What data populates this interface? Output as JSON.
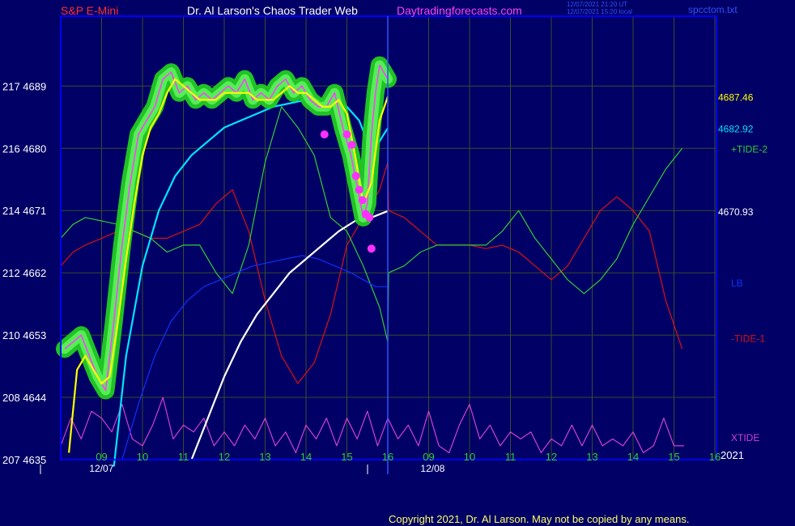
{
  "header": {
    "symbol": "S&P E-Mini",
    "site_title": "Dr. Al Larson's Chaos Trader Web",
    "site_url": "Daytradingforecasts.com",
    "time_utc": "12/07/2021 21:20 UT",
    "time_local": "12/07/2021 15:20 local",
    "file": "spcctom.txt"
  },
  "footer": {
    "copyright": "Copyright 2021, Dr. Al Larson. May not be copied by any means."
  },
  "colors": {
    "background": "#000066",
    "frame": "#0000ff",
    "grid": "#3a4d2a",
    "price_halo": "#22cc22",
    "price_line": "#ff40ff",
    "yellow_ma": "#ffff00",
    "cyan_ma": "#00e5ff",
    "white_ma": "#ffffff",
    "lb": "#1030ff",
    "tide2": "#33cc33",
    "tide1": "#dd1111",
    "xtide": "#d040d0",
    "dots": "#ff30ff"
  },
  "chart_data": {
    "type": "line",
    "title": "S&P E-Mini",
    "y_axis": {
      "ticks": [
        {
          "price": 4635,
          "label": "207  4635"
        },
        {
          "price": 4644,
          "label": "208  4644"
        },
        {
          "price": 4653,
          "label": "210  4653"
        },
        {
          "price": 4662,
          "label": "212  4662"
        },
        {
          "price": 4671,
          "label": "214  4671"
        },
        {
          "price": 4680,
          "label": "216  4680"
        },
        {
          "price": 4689,
          "label": "217  4689"
        }
      ],
      "range": [
        4635,
        4692
      ]
    },
    "x_axis": {
      "range": [
        8,
        23.25
      ],
      "hour_ticks": [
        {
          "h": 9,
          "label": "09"
        },
        {
          "h": 10,
          "label": "10"
        },
        {
          "h": 11,
          "label": "11"
        },
        {
          "h": 12,
          "label": "12"
        },
        {
          "h": 13,
          "label": "13"
        },
        {
          "h": 14,
          "label": "14"
        },
        {
          "h": 15,
          "label": "15"
        },
        {
          "h": 16,
          "label": "16"
        },
        {
          "h": 17,
          "label": "09"
        },
        {
          "h": 18,
          "label": "10"
        },
        {
          "h": 19,
          "label": "11"
        },
        {
          "h": 20,
          "label": "12"
        },
        {
          "h": 21,
          "label": "13"
        },
        {
          "h": 22,
          "label": "14"
        },
        {
          "h": 23,
          "label": "15"
        },
        {
          "h": 24,
          "label": "16"
        }
      ],
      "date_labels": [
        {
          "h": 8.7,
          "label": "12/07"
        },
        {
          "h": 16.8,
          "label": "12/08"
        }
      ],
      "year_label": "2021",
      "now_line_h": 16
    },
    "right_labels": [
      {
        "text": "4687.46",
        "price": 4687.46,
        "color": "#ffff00"
      },
      {
        "text": "4682.92",
        "price": 4682.92,
        "color": "#00e5ff"
      },
      {
        "text": "+TIDE-2",
        "price": 4680,
        "color": "#33cc33"
      },
      {
        "text": "4670.93",
        "price": 4670.93,
        "color": "#ffffff"
      },
      {
        "text": "LB",
        "price": 4660.6,
        "color": "#1030ff"
      },
      {
        "text": "-TIDE-1",
        "price": 4652.6,
        "color": "#dd1111"
      },
      {
        "text": "XTIDE",
        "price": 4638.3,
        "color": "#d040d0"
      }
    ],
    "series": [
      {
        "key": "price",
        "color": "#ff40ff",
        "halo": "#22cc22",
        "x": [
          8.1,
          8.3,
          8.5,
          8.7,
          8.9,
          9.1,
          9.3,
          9.5,
          9.7,
          9.9,
          10.1,
          10.3,
          10.5,
          10.7,
          10.9,
          11.1,
          11.3,
          11.5,
          11.7,
          11.9,
          12.1,
          12.3,
          12.5,
          12.7,
          12.9,
          13.1,
          13.3,
          13.5,
          13.7,
          13.9,
          14.1,
          14.3,
          14.5,
          14.7,
          14.9,
          15.1,
          15.2,
          15.3,
          15.4,
          15.5,
          15.6,
          15.7,
          15.8,
          15.9,
          16.0
        ],
        "y": [
          4651,
          4652,
          4653,
          4650,
          4647,
          4645,
          4655,
          4666,
          4675,
          4682,
          4684,
          4686,
          4690,
          4691,
          4688,
          4689,
          4687,
          4688,
          4687,
          4688,
          4689,
          4688,
          4690,
          4687,
          4688,
          4687,
          4689,
          4690,
          4688,
          4689,
          4687,
          4686,
          4686,
          4688,
          4683,
          4679,
          4676,
          4673,
          4670,
          4672,
          4682,
          4688,
          4692,
          4691,
          4690
        ]
      },
      {
        "key": "yellow",
        "color": "#ffff00",
        "x": [
          8.2,
          8.4,
          8.6,
          8.8,
          9.0,
          9.2,
          9.4,
          9.6,
          9.8,
          10.0,
          10.2,
          10.4,
          10.6,
          10.8,
          11.0,
          11.2,
          11.4,
          11.6,
          11.8,
          12.0,
          12.2,
          12.4,
          12.6,
          12.8,
          13.0,
          13.2,
          13.4,
          13.6,
          13.8,
          14.0,
          14.2,
          14.4,
          14.6,
          14.8,
          15.0,
          15.2,
          15.4,
          15.6,
          15.8,
          16.0
        ],
        "y": [
          4636,
          4648,
          4650,
          4648,
          4646,
          4647,
          4655,
          4664,
          4672,
          4679,
          4683,
          4685,
          4688,
          4690,
          4689,
          4688,
          4687,
          4687,
          4687,
          4688,
          4688,
          4688,
          4688,
          4687,
          4687,
          4687,
          4688,
          4689,
          4688,
          4688,
          4687,
          4686,
          4686,
          4687,
          4685,
          4679,
          4672,
          4675,
          4684,
          4687.46
        ]
      },
      {
        "key": "cyan",
        "color": "#00e5ff",
        "x": [
          9.3,
          9.6,
          10.0,
          10.4,
          10.8,
          11.2,
          11.6,
          12.0,
          12.4,
          12.8,
          13.2,
          13.6,
          14.0,
          14.4,
          14.8,
          15.0,
          15.3,
          15.5,
          15.7,
          15.9,
          16.0
        ],
        "y": [
          4634,
          4650,
          4663,
          4671,
          4676,
          4679,
          4681,
          4683,
          4684,
          4685,
          4686,
          4686.5,
          4687,
          4687,
          4686.5,
          4686,
          4684,
          4681,
          4680,
          4682,
          4682.92
        ]
      },
      {
        "key": "white",
        "color": "#ffffff",
        "x": [
          11.2,
          11.6,
          12.0,
          12.4,
          12.8,
          13.2,
          13.6,
          14.0,
          14.4,
          14.8,
          15.2,
          15.6,
          16.0
        ],
        "y": [
          4635,
          4641,
          4647,
          4652,
          4656,
          4659,
          4662,
          4664,
          4666,
          4668,
          4669.5,
          4670,
          4670.93
        ]
      },
      {
        "key": "lb",
        "color": "#1030ff",
        "x": [
          9.5,
          9.9,
          10.3,
          10.7,
          11.1,
          11.5,
          11.9,
          12.3,
          12.7,
          13.1,
          13.5,
          13.9,
          14.3,
          14.7,
          15.1,
          15.4,
          15.7,
          16.0
        ],
        "y": [
          4635,
          4643,
          4650,
          4655,
          4658,
          4660,
          4661,
          4662,
          4663,
          4663.5,
          4664,
          4664.5,
          4664,
          4663,
          4662,
          4661,
          4660,
          4660
        ]
      },
      {
        "key": "tide2",
        "color": "#33cc33",
        "x": [
          8.0,
          8.3,
          8.6,
          9.0,
          9.4,
          9.8,
          10.2,
          10.6,
          11.0,
          11.4,
          11.8,
          12.2,
          12.6,
          13.0,
          13.4,
          13.8,
          14.2,
          14.6,
          15.0,
          15.4,
          15.8,
          16.0,
          16.02,
          16.4,
          16.8,
          17.2,
          17.6,
          18.0,
          18.4,
          18.8,
          19.2,
          19.6,
          20.0,
          20.4,
          20.8,
          21.2,
          21.6,
          22.0,
          22.4,
          22.8,
          23.2
        ],
        "y": [
          4667,
          4669,
          4670,
          4669.5,
          4669,
          4668,
          4667,
          4665,
          4666,
          4666,
          4662,
          4659,
          4666,
          4678,
          4686,
          4683,
          4679,
          4670,
          4668,
          4663,
          4657,
          4652,
          4662,
          4663,
          4665,
          4666,
          4666,
          4666,
          4666,
          4668,
          4671,
          4667,
          4664,
          4661,
          4659,
          4661,
          4664,
          4669,
          4673,
          4677,
          4680
        ]
      },
      {
        "key": "tide1",
        "color": "#dd1111",
        "x": [
          8.0,
          8.3,
          8.6,
          9.0,
          9.4,
          9.8,
          10.2,
          10.6,
          11.0,
          11.4,
          11.8,
          12.2,
          12.6,
          13.0,
          13.4,
          13.8,
          14.2,
          14.6,
          15.0,
          15.4,
          15.8,
          16.0,
          16.02,
          16.4,
          16.8,
          17.2,
          17.6,
          18.0,
          18.4,
          18.8,
          19.2,
          19.6,
          20.0,
          20.4,
          20.8,
          21.2,
          21.6,
          22.0,
          22.4,
          22.8,
          23.2
        ],
        "y": [
          4663,
          4665,
          4666,
          4667,
          4668,
          4668,
          4667,
          4667,
          4668,
          4669,
          4672,
          4674,
          4668,
          4658,
          4650,
          4646,
          4649,
          4656,
          4666,
          4670,
          4674,
          4678,
          4671,
          4670,
          4668,
          4666,
          4666,
          4666,
          4665.5,
          4666,
          4665,
          4663,
          4661,
          4663,
          4667,
          4671,
          4673,
          4671,
          4668,
          4658,
          4651
        ]
      },
      {
        "key": "xtide",
        "color": "#d040d0",
        "x": [
          8.0,
          8.25,
          8.5,
          8.75,
          9.0,
          9.25,
          9.5,
          9.75,
          10.0,
          10.25,
          10.5,
          10.75,
          11.0,
          11.25,
          11.5,
          11.75,
          12.0,
          12.25,
          12.5,
          12.75,
          13.0,
          13.25,
          13.5,
          13.75,
          14.0,
          14.25,
          14.5,
          14.75,
          15.0,
          15.25,
          15.5,
          15.75,
          16.0,
          16.25,
          16.5,
          16.75,
          17.0,
          17.25,
          17.5,
          17.75,
          18.0,
          18.25,
          18.5,
          18.75,
          19.0,
          19.25,
          19.5,
          19.75,
          20.0,
          20.25,
          20.5,
          20.75,
          21.0,
          21.25,
          21.5,
          21.75,
          22.0,
          22.25,
          22.5,
          22.75,
          23.0,
          23.25
        ],
        "y": [
          4637,
          4641,
          4638,
          4642,
          4641,
          4639,
          4643,
          4638,
          4637,
          4640,
          4644,
          4638,
          4640,
          4639,
          4641,
          4637,
          4639,
          4637,
          4640,
          4638,
          4641,
          4637,
          4639,
          4636,
          4640,
          4638,
          4641,
          4637,
          4641,
          4638,
          4642,
          4637,
          4641,
          4638,
          4640,
          4637,
          4642,
          4637,
          4636,
          4640,
          4643,
          4638,
          4640,
          4637,
          4639,
          4638,
          4639,
          4636,
          4638,
          4637,
          4640,
          4637,
          4640,
          4637,
          4638,
          4637,
          4639,
          4636,
          4637,
          4641,
          4637,
          4637
        ]
      }
    ],
    "dots": [
      {
        "x": 14.45,
        "y": 4682
      },
      {
        "x": 15.0,
        "y": 4682
      },
      {
        "x": 15.12,
        "y": 4680.5
      },
      {
        "x": 15.22,
        "y": 4676
      },
      {
        "x": 15.3,
        "y": 4674
      },
      {
        "x": 15.38,
        "y": 4672.5
      },
      {
        "x": 15.46,
        "y": 4670.5
      },
      {
        "x": 15.55,
        "y": 4670
      },
      {
        "x": 15.6,
        "y": 4665.5
      }
    ]
  }
}
